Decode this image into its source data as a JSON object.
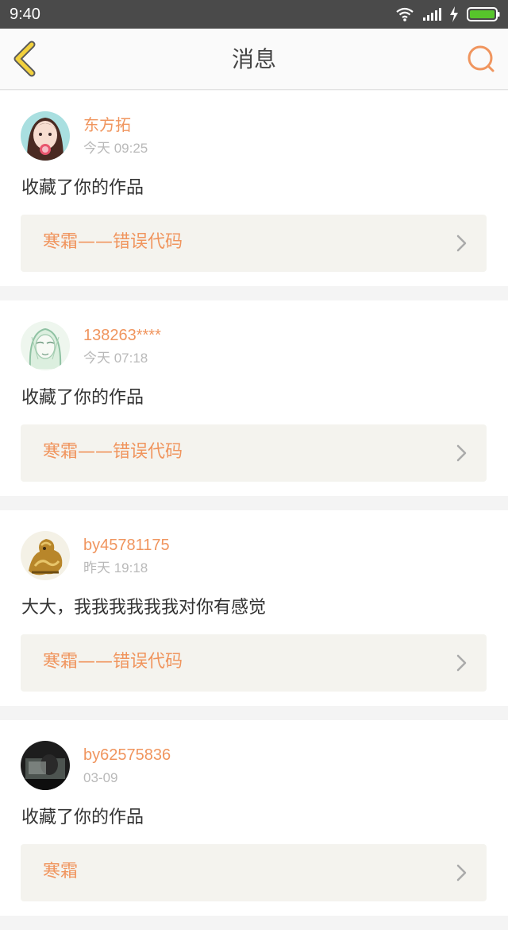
{
  "status_bar": {
    "time": "9:40",
    "icons": [
      "wifi-icon",
      "signal-icon",
      "charging-icon",
      "battery-icon"
    ],
    "battery_color": "#57c52b"
  },
  "header": {
    "title": "消息",
    "back_icon": "chevron-left-icon",
    "search_icon": "search-icon",
    "accent_color": "#f0955e",
    "back_color": "#f2d13d"
  },
  "messages": [
    {
      "user": "东方拓",
      "time": "今天 09:25",
      "text": "收藏了你的作品",
      "work": "寒霜——错误代码",
      "avatar": "avatar-girl-lollipop"
    },
    {
      "user": "138263****",
      "time": "今天 07:18",
      "text": "收藏了你的作品",
      "work": "寒霜——错误代码",
      "avatar": "avatar-sketch-girl"
    },
    {
      "user": "by45781175",
      "time": "昨天 19:18",
      "text": "大大，我我我我我我对你有感觉",
      "work": "寒霜——错误代码",
      "avatar": "avatar-golden-dragon"
    },
    {
      "user": "by62575836",
      "time": "03-09",
      "text": "收藏了你的作品",
      "work": "寒霜",
      "avatar": "avatar-dark-photo"
    }
  ]
}
